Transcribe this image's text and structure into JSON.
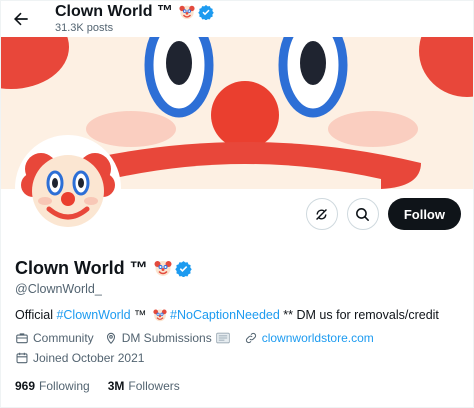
{
  "header": {
    "title": "Clown World ™",
    "posts_count": "31.3K posts",
    "back_icon": "arrow-left-icon"
  },
  "banner": {
    "image": "clown-face-closeup"
  },
  "avatar": {
    "image": "clown-face-emoji"
  },
  "actions": {
    "more_icon": "more-options-icon",
    "search_icon": "search-icon",
    "follow_label": "Follow"
  },
  "profile": {
    "name": "Clown World ™",
    "handle": "@ClownWorld_",
    "bio": {
      "prefix": "Official ",
      "hashtag1": "#ClownWorld",
      "mid": " ™ ",
      "hashtag2": "#NoCaptionNeeded",
      "suffix": " ** DM us for removals/credit"
    },
    "category": "Community",
    "location": "DM Submissions",
    "website": "clownworldstore.com",
    "joined": "Joined October 2021"
  },
  "stats": {
    "following_count": "969",
    "following_label": "Following",
    "followers_count": "3M",
    "followers_label": "Followers"
  },
  "colors": {
    "accent": "#1d9bf0",
    "text": "#0f1419",
    "secondary": "#536471",
    "button": "#0f1419"
  }
}
